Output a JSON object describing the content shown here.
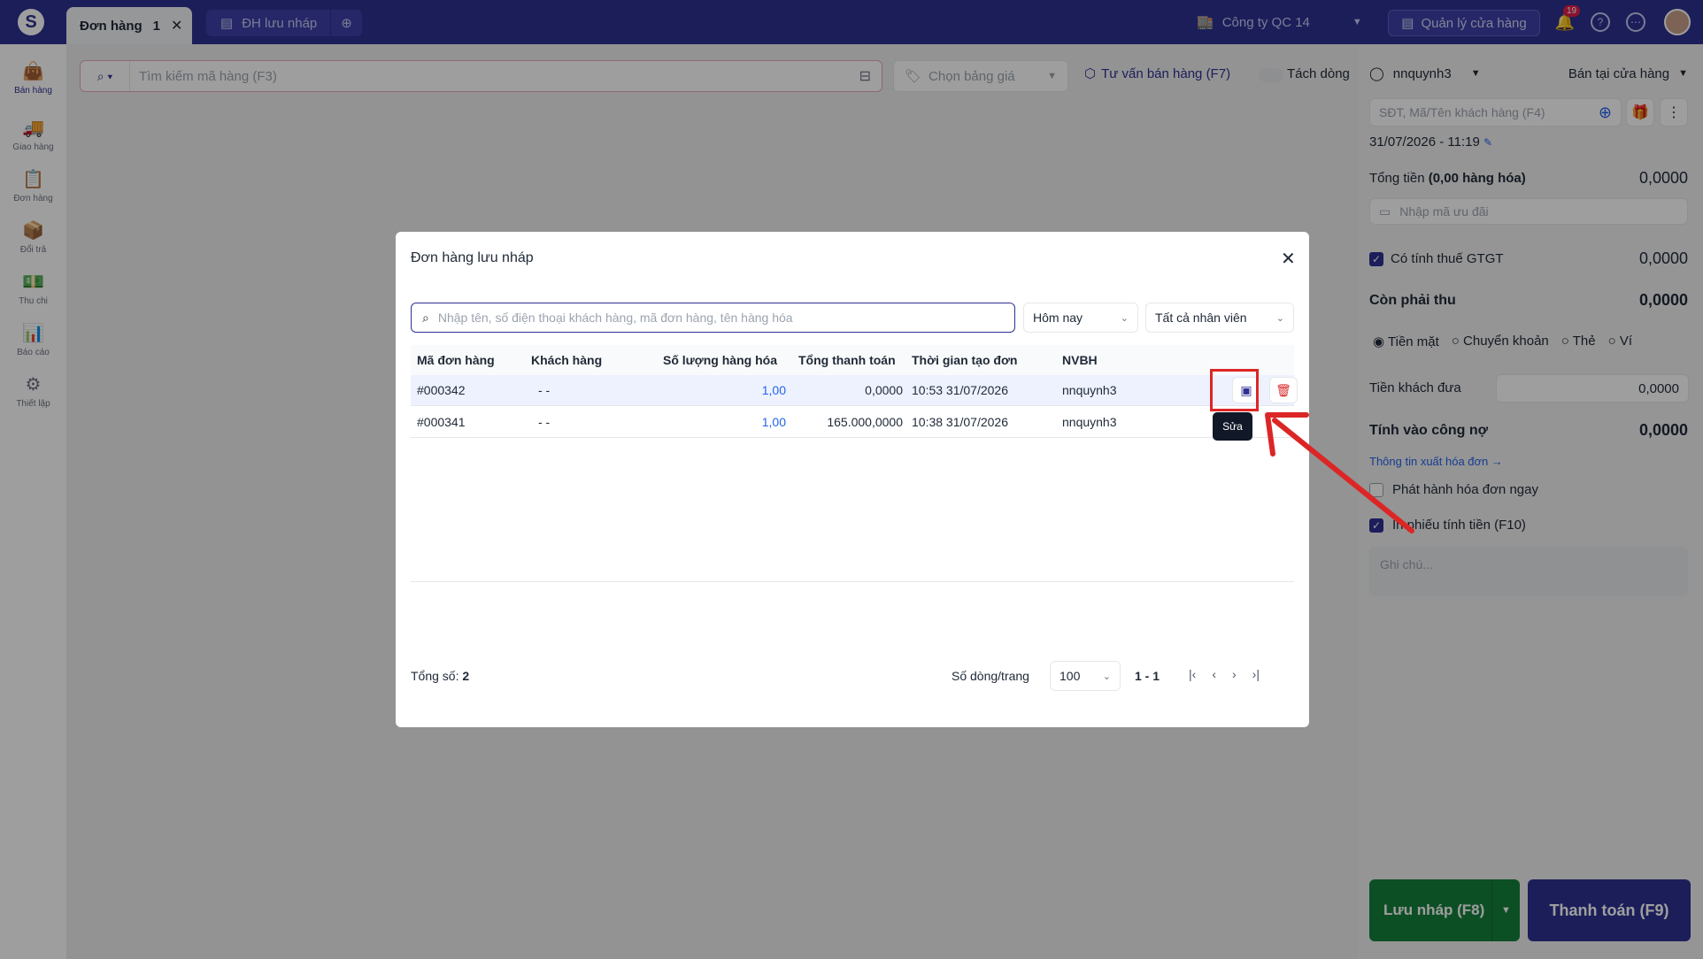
{
  "topbar": {
    "tabs": [
      {
        "label": "Đơn hàng",
        "count": "1"
      },
      {
        "label": "ĐH lưu nháp"
      }
    ],
    "company": "Công ty QC 14",
    "shop_button": "Quản lý cửa hàng",
    "notif_count": "19"
  },
  "sidebar": {
    "items": [
      {
        "label": "Bán hàng",
        "icon": "shopping-bag-icon"
      },
      {
        "label": "Giao hàng",
        "icon": "truck-icon"
      },
      {
        "label": "Đơn hàng",
        "icon": "clipboard-icon"
      },
      {
        "label": "Đổi trả",
        "icon": "box-return-icon"
      },
      {
        "label": "Thu chi",
        "icon": "cash-icon"
      },
      {
        "label": "Báo cáo",
        "icon": "chart-icon"
      },
      {
        "label": "Thiết lập",
        "icon": "gear-icon"
      }
    ]
  },
  "toolbar": {
    "search_placeholder": "Tìm kiếm mã hàng (F3)",
    "price_placeholder": "Chọn bảng giá",
    "advise": "Tư vấn bán hàng (F7)",
    "split": "Tách dòng"
  },
  "panel": {
    "user": "nnquynh3",
    "mode": "Bán tại cửa hàng",
    "customer_placeholder": "SĐT, Mã/Tên khách hàng (F4)",
    "datetime": "31/07/2026 - 11:19",
    "total_label": "Tổng tiền",
    "total_goods": "(0,00 hàng hóa)",
    "total_value": "0,0000",
    "promo_placeholder": "Nhập mã ưu đãi",
    "vat_label": "Có tính thuế GTGT",
    "vat_value": "0,0000",
    "due_label": "Còn phải thu",
    "due_value": "0,0000",
    "pay_methods": [
      "Tiền mặt",
      "Chuyển khoản",
      "Thẻ",
      "Ví"
    ],
    "given_label": "Tiền khách đưa",
    "given_value": "0,0000",
    "debt_label": "Tính vào công nợ",
    "debt_value": "0,0000",
    "invoice_link": "Thông tin xuất hóa đơn →",
    "issue_now": "Phát hành hóa đơn ngay",
    "print_label": "In phiếu tính tiền (F10)",
    "note_placeholder": "Ghi chú...",
    "save_draft": "Lưu nháp (F8)",
    "pay": "Thanh toán (F9)"
  },
  "modal": {
    "title": "Đơn hàng lưu nháp",
    "search_placeholder": "Nhập tên, số điện thoại khách hàng, mã đơn hàng, tên hàng hóa",
    "date_filter": "Hôm nay",
    "staff_filter": "Tất cả nhân viên",
    "columns": [
      "Mã đơn hàng",
      "Khách hàng",
      "Số lượng hàng hóa",
      "Tổng thanh toán",
      "Thời gian tạo đơn",
      "NVBH"
    ],
    "rows": [
      {
        "code": "#000342",
        "customer": "- -",
        "qty": "1,00",
        "total": "0,0000",
        "time": "10:53 31/07/2026",
        "staff": "nnquynh3"
      },
      {
        "code": "#000341",
        "customer": "- -",
        "qty": "1,00",
        "total": "165.000,0000",
        "time": "10:38 31/07/2026",
        "staff": "nnquynh3"
      }
    ],
    "tooltip": "Sửa",
    "total_label": "Tổng số:",
    "total_count": "2",
    "per_page_label": "Số dòng/trang",
    "per_page": "100",
    "range": "1 - 1"
  },
  "colors": {
    "brand": "#2e3192",
    "green": "#15803d",
    "highlight": "#dc2626"
  }
}
